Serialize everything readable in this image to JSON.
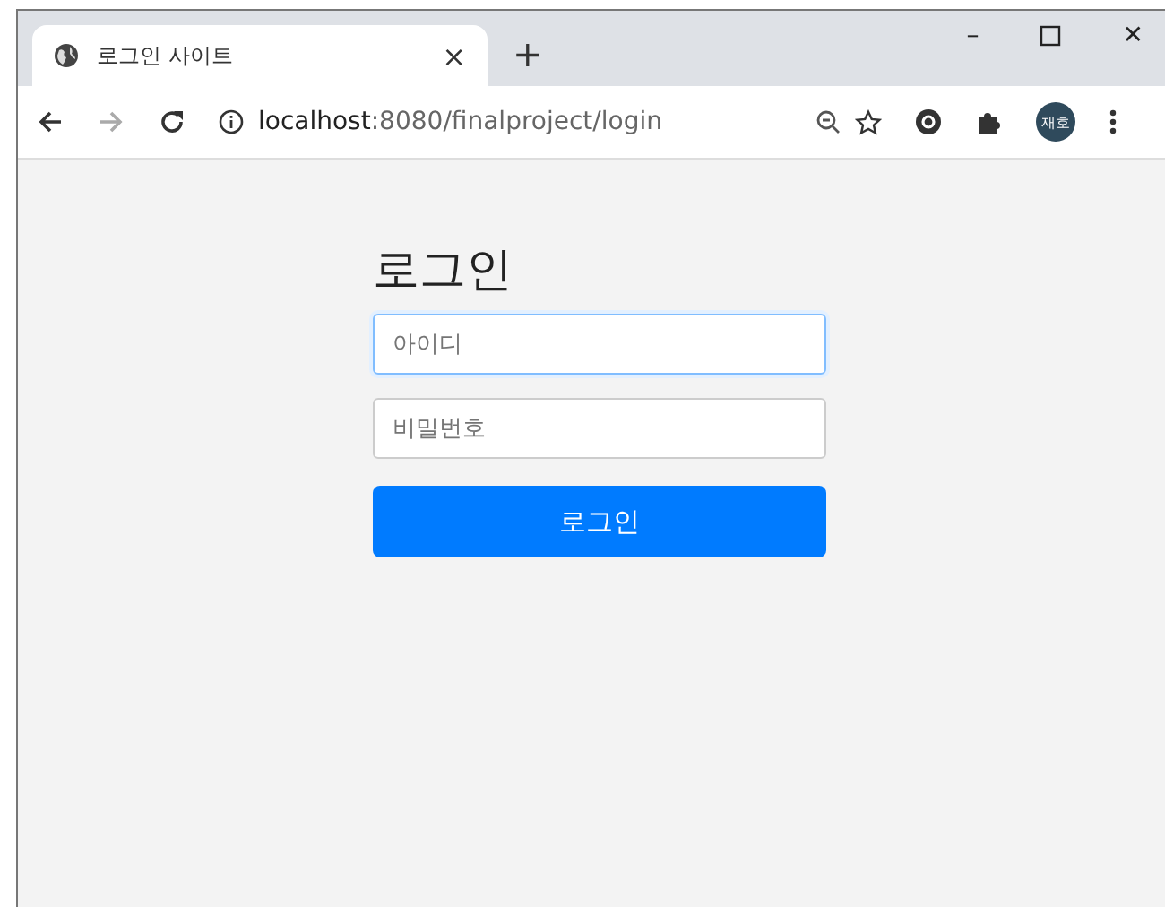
{
  "tab": {
    "title": "로그인 사이트",
    "close": "×"
  },
  "new_tab": "+",
  "window_controls": {
    "minimize": "–",
    "close": "✕"
  },
  "address": {
    "host": "localhost",
    "path": ":8080/finalproject/login"
  },
  "profile": {
    "initials": "재호"
  },
  "page": {
    "heading": "로그인",
    "fields": [
      {
        "placeholder": "아이디",
        "focused": true
      },
      {
        "placeholder": "비밀번호",
        "focused": false
      }
    ],
    "button": "로그인"
  }
}
